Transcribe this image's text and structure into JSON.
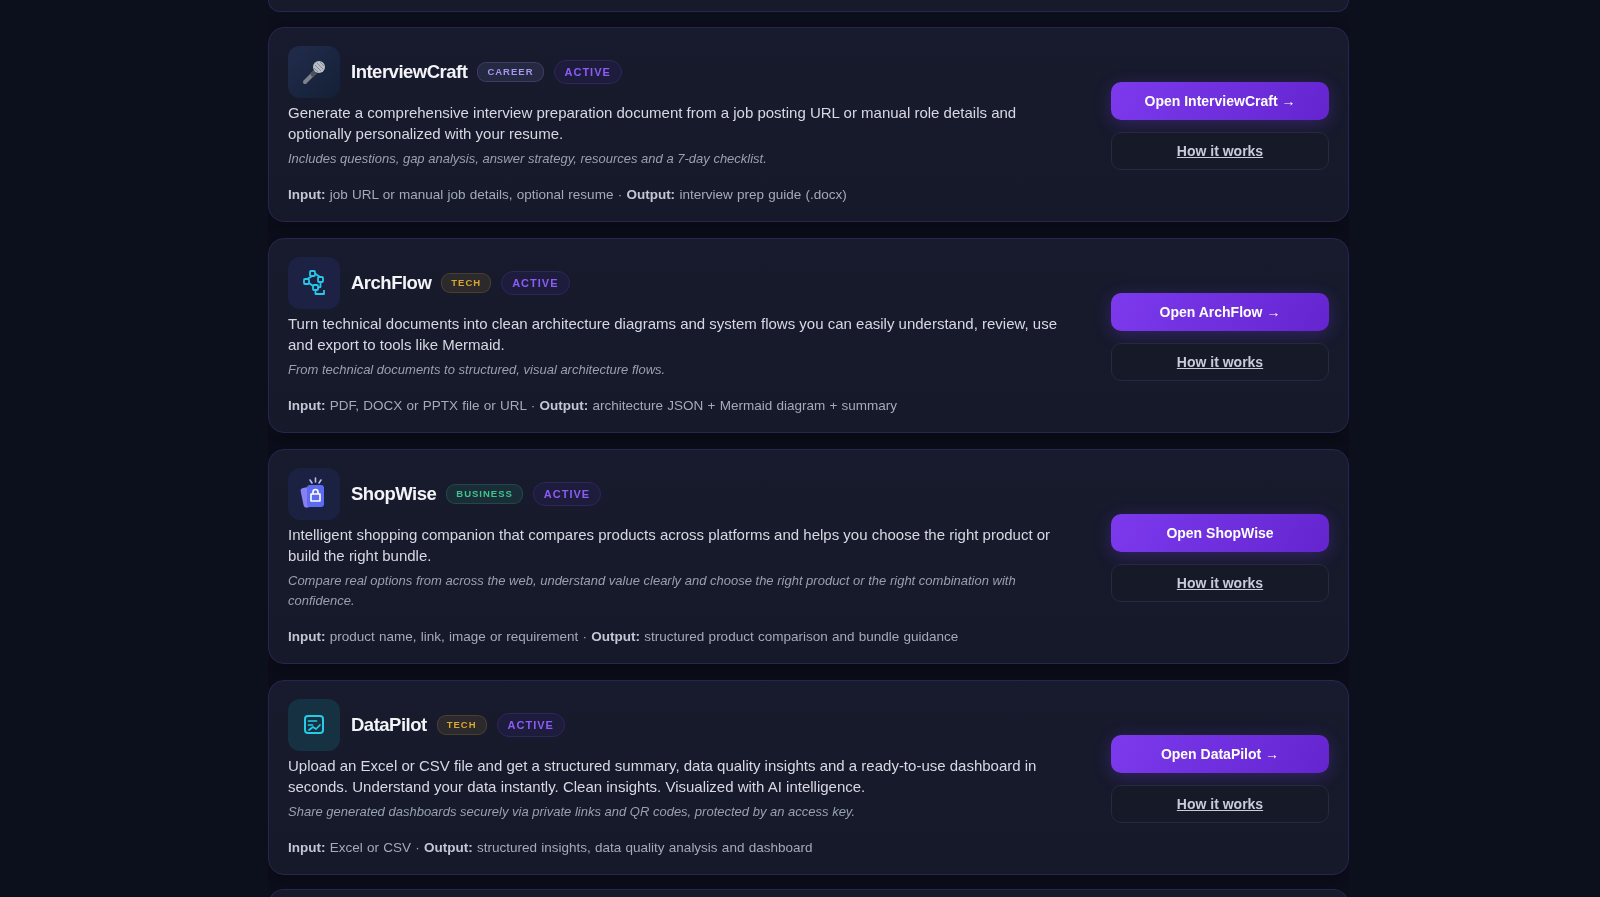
{
  "tools": [
    {
      "name": "InterviewCraft",
      "category": {
        "label": "CAREER",
        "color": "#a597ee"
      },
      "status": "ACTIVE",
      "description": "Generate a comprehensive interview preparation document from a job posting URL or manual role details and optionally personalized with your resume.",
      "note": "Includes questions, gap analysis, answer strategy, resources and a 7-day checklist.",
      "meta": "**Input:** job URL or manual job details, optional resume · **Output:** interview prep guide (.docx)",
      "open_button": "Open InterviewCraft →",
      "help_button": "How it works"
    },
    {
      "name": "ArchFlow",
      "category": {
        "label": "TECH",
        "color": "#d9a62e"
      },
      "status": "ACTIVE",
      "description": "Turn technical documents into clean architecture diagrams and system flows you can easily understand, review, use and export to tools like Mermaid.",
      "note": "From technical documents to structured, visual architecture flows.",
      "meta": "**Input:** PDF, DOCX or PPTX file or URL · **Output:** architecture JSON + Mermaid diagram + summary",
      "open_button": "Open ArchFlow →",
      "help_button": "How it works"
    },
    {
      "name": "ShopWise",
      "category": {
        "label": "BUSINESS",
        "color": "#3fc48f"
      },
      "status": "ACTIVE",
      "description": "Intelligent shopping companion that compares products across platforms and helps you choose the right product or build the right bundle.",
      "note": "Compare real options from across the web, understand value clearly and choose the right product or the right combination with confidence.",
      "meta": "**Input:** product name, link, image or requirement · **Output:** structured product comparison and bundle guidance",
      "open_button": "Open ShopWise",
      "help_button": "How it works"
    },
    {
      "name": "DataPilot",
      "category": {
        "label": "TECH",
        "color": "#d9a62e"
      },
      "status": "ACTIVE",
      "description": "Upload an Excel or CSV file and get a structured summary, data quality insights and a ready-to-use dashboard in seconds. Understand your data instantly. Clean insights. Visualized with AI intelligence.",
      "note": "Share generated dashboards securely via private links and QR codes, protected by an access key.",
      "meta": "**Input:** Excel or CSV · **Output:** structured insights, data quality analysis and dashboard",
      "open_button": "Open DataPilot →",
      "help_button": "How it works"
    }
  ]
}
